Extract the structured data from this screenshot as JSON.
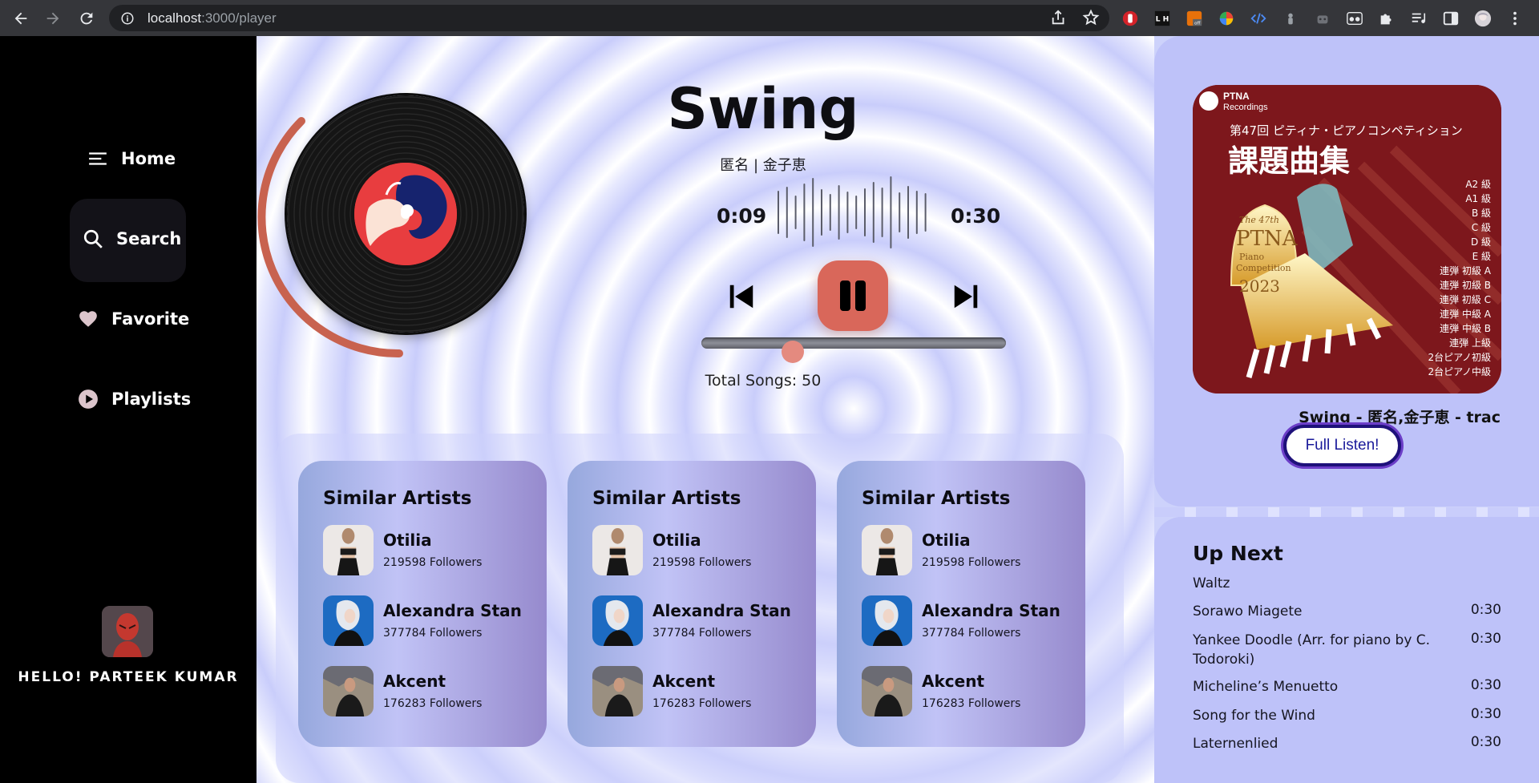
{
  "browser": {
    "url_host": "localhost",
    "url_rest": ":3000/player",
    "ext_badge": "off",
    "ext_lh": "L H"
  },
  "sidebar": {
    "home_label": "Home",
    "search_label": "Search",
    "favorite_label": "Favorite",
    "playlists_label": "Playlists",
    "greeting": "HELLO! PARTEEK KUMAR"
  },
  "player": {
    "title": "Swing",
    "artists": "匿名 | 金子恵",
    "elapsed": "0:09",
    "duration": "0:30",
    "progress_fraction": 0.3,
    "total_songs": "Total Songs: 50"
  },
  "similar_cards": [
    {
      "title": "Similar Artists",
      "artists": [
        {
          "name": "Otilia",
          "followers": "219598 Followers"
        },
        {
          "name": "Alexandra Stan",
          "followers": "377784 Followers"
        },
        {
          "name": "Akcent",
          "followers": "176283 Followers"
        }
      ]
    },
    {
      "title": "Similar Artists",
      "artists": [
        {
          "name": "Otilia",
          "followers": "219598 Followers"
        },
        {
          "name": "Alexandra Stan",
          "followers": "377784 Followers"
        },
        {
          "name": "Akcent",
          "followers": "176283 Followers"
        }
      ]
    },
    {
      "title": "Similar Artists",
      "artists": [
        {
          "name": "Otilia",
          "followers": "219598 Followers"
        },
        {
          "name": "Alexandra Stan",
          "followers": "377784 Followers"
        },
        {
          "name": "Akcent",
          "followers": "176283 Followers"
        }
      ]
    }
  ],
  "now_playing": {
    "cover": {
      "brand": "PTNA",
      "brand_sub": "Recordings",
      "subtitle": "第47回 ピティナ・ピアノコンペティション",
      "title": "課題曲集",
      "badge_lines": [
        "The 47th",
        "PTNA",
        "Piano",
        "Competition",
        "2023"
      ],
      "grades": [
        "A2 級",
        "A1 級",
        "B 級",
        "C 級",
        "D 級",
        "E 級",
        "連弾 初級 A",
        "連弾 初級 B",
        "連弾 初級 C",
        "連弾 中級 A",
        "連弾 中級 B",
        "連弾 上級",
        "2台ピアノ初級",
        "2台ピアノ中級"
      ]
    },
    "track_label": "Swing - 匿名,金子恵 - trac",
    "full_listen": "Full Listen!"
  },
  "up_next": {
    "title": "Up Next",
    "items": [
      {
        "name": "Waltz",
        "time": ""
      },
      {
        "name": "Sorawo Miagete",
        "time": "0:30"
      },
      {
        "name": "Yankee Doodle (Arr. for piano by C. Todoroki)",
        "time": "0:30"
      },
      {
        "name": "Micheline’s Menuetto",
        "time": "0:30"
      },
      {
        "name": "Song for the Wind",
        "time": "0:30"
      },
      {
        "name": "Laternenlied",
        "time": "0:30"
      }
    ]
  },
  "colors": {
    "accent": "#d9675a",
    "panel": "#bec2f9",
    "sidebar": "#000000"
  }
}
